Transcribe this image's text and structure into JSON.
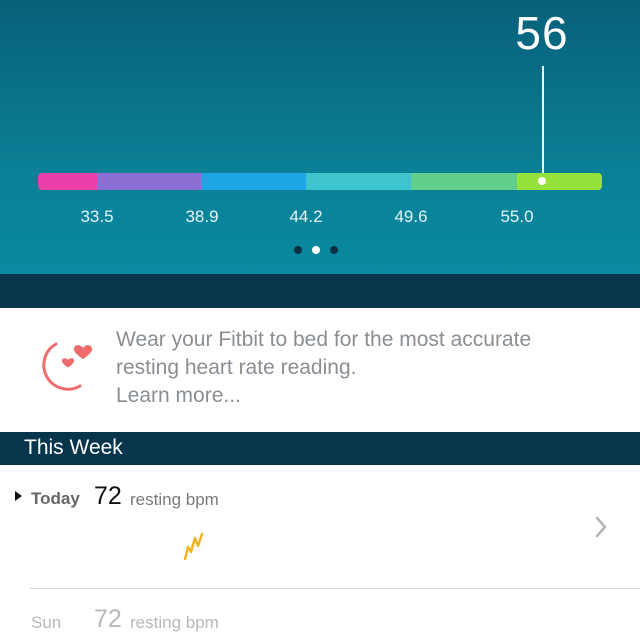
{
  "hero": {
    "current_value": "56",
    "current_value_number": 56,
    "scale_ticks": [
      "33.5",
      "38.9",
      "44.2",
      "49.6",
      "55.0"
    ],
    "scale_colors": [
      "#e93fa8",
      "#8c6fd4",
      "#1ea6e6",
      "#3ec4cf",
      "#5fcf8b",
      "#96e23c"
    ],
    "pager_count": 3,
    "pager_active_index": 1
  },
  "tip": {
    "icon": "moon-heart-icon",
    "line1": "Wear your Fitbit to bed for the most accurate",
    "line2": "resting heart rate reading.",
    "link": "Learn more..."
  },
  "this_week": {
    "header": "This Week",
    "rows": [
      {
        "day": "Today",
        "value": "72",
        "unit": "resting bpm",
        "icon": "lightning-icon"
      },
      {
        "day": "Sun",
        "value": "72",
        "unit": "resting bpm"
      }
    ]
  },
  "colors": {
    "accent_dark": "#08354c",
    "hero_teal": "#0b7f95",
    "icon_coral": "#f06b6b"
  }
}
